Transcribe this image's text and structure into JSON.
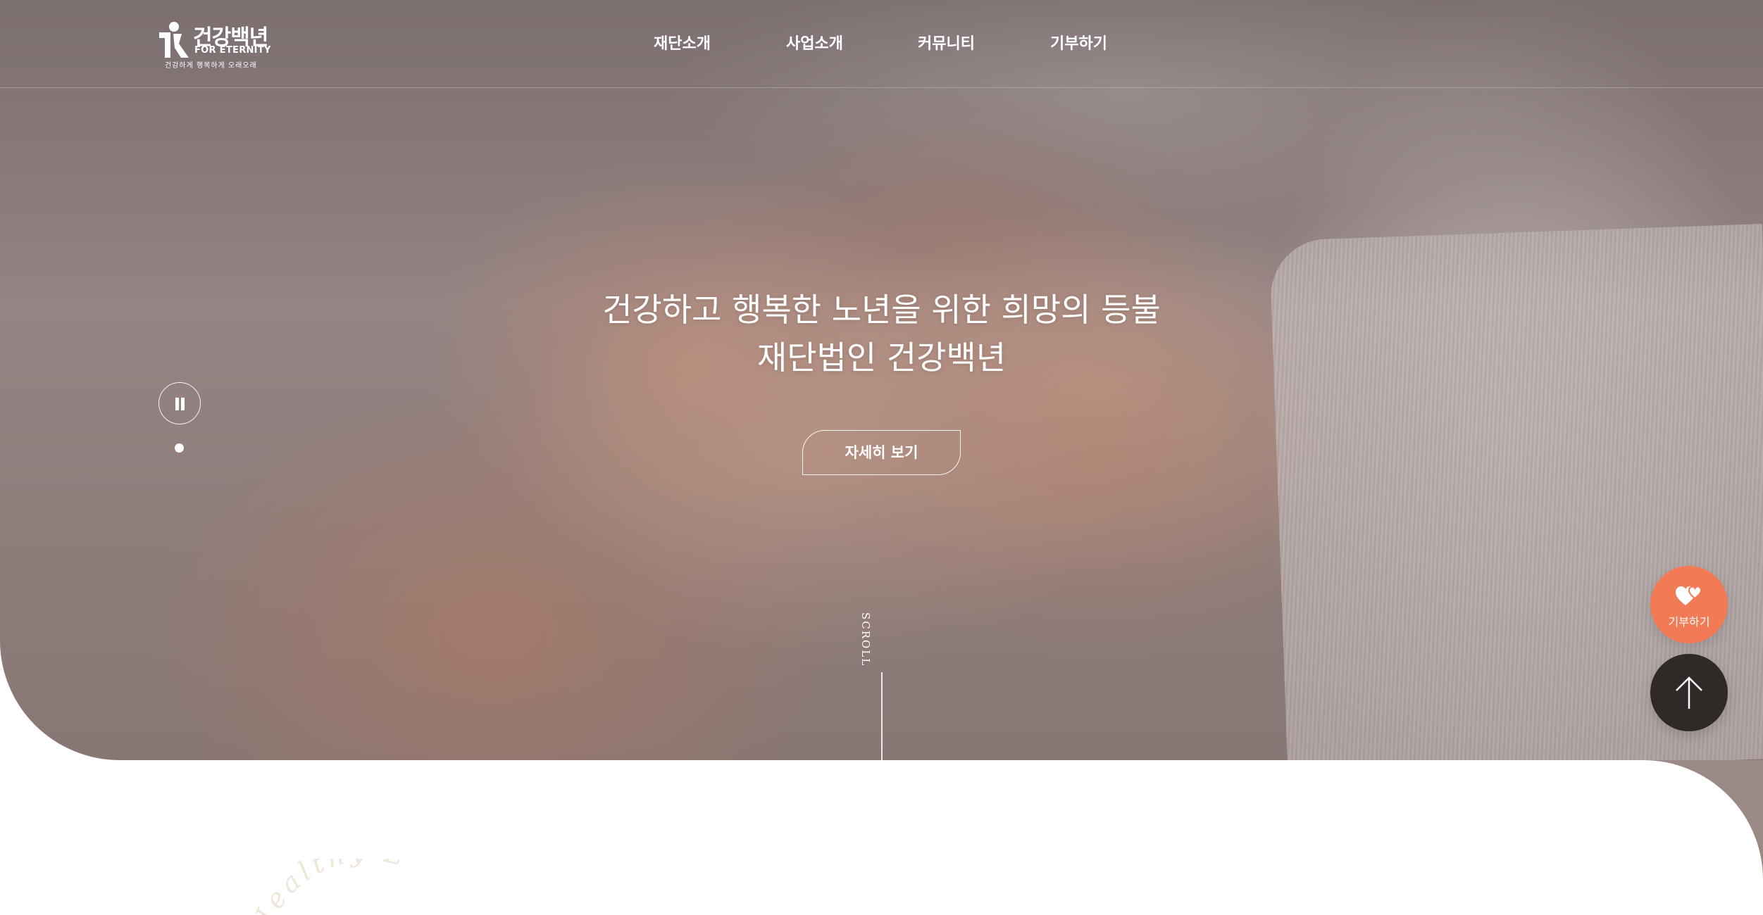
{
  "header": {
    "logo": {
      "title": "건강백년",
      "english": "FOR ETERNITY",
      "tagline": "건강하게  행복하게  오래오래"
    },
    "nav": [
      {
        "label": "재단소개"
      },
      {
        "label": "사업소개"
      },
      {
        "label": "커뮤니티"
      },
      {
        "label": "기부하기"
      }
    ]
  },
  "hero": {
    "title_line1": "건강하고 행복한 노년을 위한 희망의 등불",
    "title_line2": "재단법인 건강백년",
    "detail_button": "자세히 보기",
    "scroll_label": "SCROLL",
    "slider": {
      "state": "playing",
      "total_slides": 1,
      "active_slide": 1
    }
  },
  "floating": {
    "donate_label": "기부하기",
    "top_icon": "arrow-up-icon",
    "donate_icon": "hearts-icon"
  },
  "section": {
    "arc_text": "Healthy L"
  },
  "colors": {
    "accent": "#f27b56",
    "dark_button": "#2f2a28",
    "arc_text": "#efe6d8"
  }
}
